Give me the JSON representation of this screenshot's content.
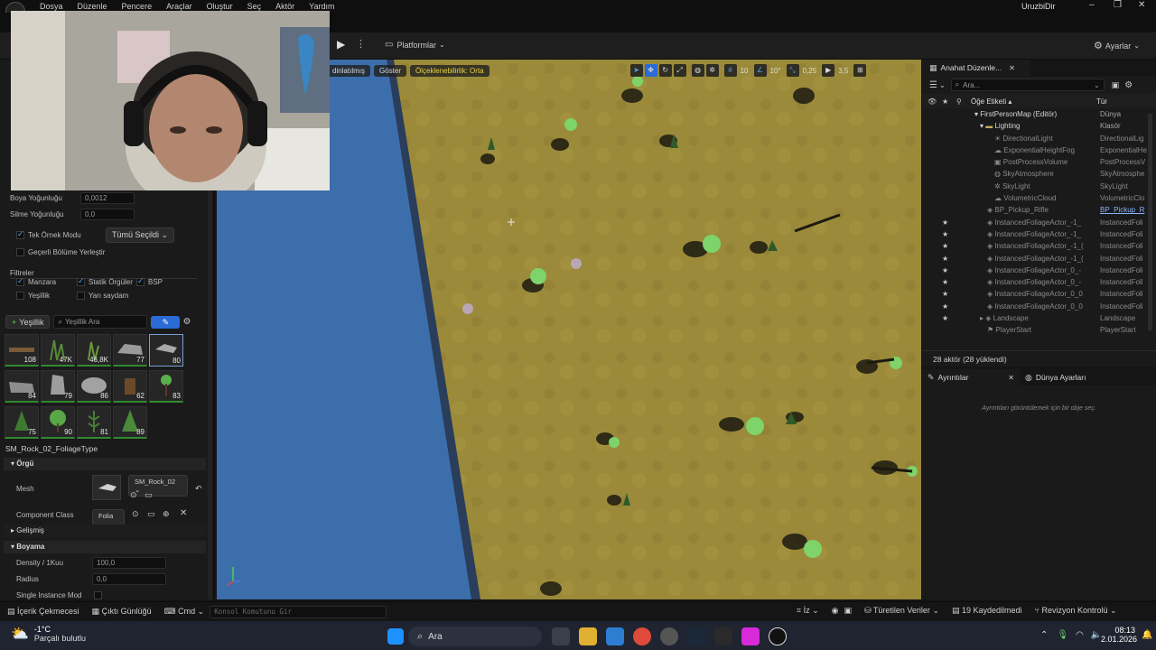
{
  "menu": [
    "Dosya",
    "Düzenle",
    "Pencere",
    "Araçlar",
    "Oluştur",
    "Seç",
    "Aktör",
    "Yardım"
  ],
  "window": {
    "project_name": "UruzbiDir"
  },
  "toolbar": {
    "platforms_label": "Platformlar",
    "settings_label": "Ayarlar"
  },
  "left_panel": {
    "paint_density_label": "Boya Yoğunluğu",
    "paint_density_value": "0,0012",
    "erase_density_label": "Silme Yoğunluğu",
    "erase_density_value": "0,0",
    "single_instance_label": "Tek Örnek Modu",
    "single_instance_value": "Tümü Seçildi",
    "place_current_level_label": "Geçerli Bölüme Yerleştir",
    "filters_label": "Filtreler",
    "filters": [
      {
        "label": "Manzara",
        "checked": true
      },
      {
        "label": "Statik Örgüler",
        "checked": true
      },
      {
        "label": "BSP",
        "checked": true
      },
      {
        "label": "Yeşillik",
        "checked": false
      },
      {
        "label": "Yarı saydam",
        "checked": false
      }
    ],
    "foliage_button": "Yeşillik",
    "foliage_search_placeholder": "Yeşillik Ara",
    "thumb_counts": [
      "108",
      "47K",
      "46,8K",
      "77",
      "80",
      "84",
      "79",
      "86",
      "62",
      "83",
      "75",
      "90",
      "81",
      "89"
    ],
    "selected_type": "SM_Rock_02_FoliageType",
    "mesh_section": "Örgü",
    "mesh_label": "Mesh",
    "mesh_value": "SM_Rock_02",
    "component_class_label": "Component Class",
    "component_class_value": "Folia",
    "advanced_label": "Gelişmiş",
    "painting_section": "Boyama",
    "density_label": "Density / 1Kuu",
    "density_value": "100,0",
    "radius_label": "Radius",
    "radius_value": "0,0",
    "single_instance_mode_label": "Single Instance Mod"
  },
  "viewport": {
    "view_mode": "dinlatılmış",
    "show_label": "Göster",
    "scalability_label": "Ölçeklenebilirlik: Orta",
    "grid_value": "10",
    "angle_value": "10°",
    "scale_value": "0,25",
    "camera_speed": "3,5"
  },
  "outliner": {
    "tab_label": "Anahat Düzenle...",
    "search_placeholder": "Ara...",
    "col_label": "Öğe Etiketi",
    "col_type": "Tür",
    "rows": [
      {
        "name": "FirstPersonMap (Editör)",
        "type": "Dünya"
      },
      {
        "name": "Lighting",
        "type": "Klasör"
      },
      {
        "name": "DirectionalLight",
        "type": "DirectionalLig"
      },
      {
        "name": "ExponentialHeightFog",
        "type": "ExponentialHe"
      },
      {
        "name": "PostProcessVolume",
        "type": "PostProcessV"
      },
      {
        "name": "SkyAtmosphere",
        "type": "SkyAtmosphe"
      },
      {
        "name": "SkyLight",
        "type": "SkyLight"
      },
      {
        "name": "VolumetricCloud",
        "type": "VolumetricClo"
      },
      {
        "name": "BP_Pickup_Rifle",
        "type": "BP_Pickup_R"
      },
      {
        "name": "InstancedFoliageActor_-1_",
        "type": "InstancedFoli"
      },
      {
        "name": "InstancedFoliageActor_-1_",
        "type": "InstancedFoli"
      },
      {
        "name": "InstancedFoliageActor_-1_(",
        "type": "InstancedFoli"
      },
      {
        "name": "InstancedFoliageActor_-1_(",
        "type": "InstancedFoli"
      },
      {
        "name": "InstancedFoliageActor_0_-",
        "type": "InstancedFoli"
      },
      {
        "name": "InstancedFoliageActor_0_-",
        "type": "InstancedFoli"
      },
      {
        "name": "InstancedFoliageActor_0_0",
        "type": "InstancedFoli"
      },
      {
        "name": "InstancedFoliageActor_0_0",
        "type": "InstancedFoli"
      },
      {
        "name": "Landscape",
        "type": "Landscape"
      },
      {
        "name": "PlayerStart",
        "type": "PlayerStart"
      }
    ],
    "actor_count": "28 aktör (28 yüklendi)"
  },
  "details": {
    "tab_label": "Ayrıntılar",
    "world_settings_label": "Dünya Ayarları",
    "empty_text": "Ayrıntıları görüntülemek için bir obje seç."
  },
  "statusbar": {
    "content_drawer": "İçerik Çekmecesi",
    "output_log": "Çıktı Günlüğü",
    "cmd_label": "Cmd",
    "console_placeholder": "Konsol Komutunu Gir",
    "trace_label": "İz",
    "derived_data": "Türetilen Veriler",
    "unsaved": "19 Kaydedilmedi",
    "revision_control": "Revizyon Kontrolü"
  },
  "taskbar": {
    "temperature": "-1°C",
    "weather": "Parçalı bulutlu",
    "search_label": "Ara",
    "time": "08:13",
    "date": "2.01.2026"
  },
  "colors": {
    "accent": "#4ea1ff",
    "terrain": "#9c8b3a",
    "water": "#3c6eab",
    "scalability_text": "#e8d34a"
  }
}
